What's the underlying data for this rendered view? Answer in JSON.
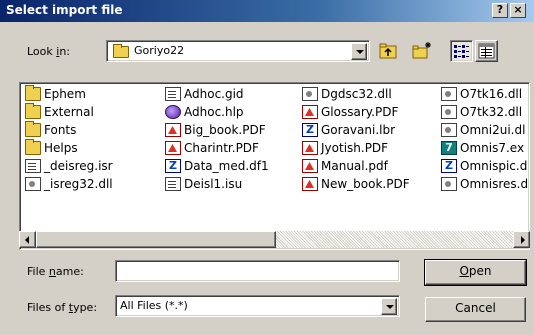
{
  "window": {
    "title": "Select import file",
    "help_label": "?",
    "close_label": "×"
  },
  "lookin": {
    "label_pre": "Look ",
    "label_key": "i",
    "label_post": "n:",
    "value": "Goriyo22"
  },
  "toolbar": {
    "up_icon": "folder-up-icon",
    "new_folder_icon": "new-folder-icon",
    "list_view_icon": "list-view-icon",
    "details_view_icon": "details-view-icon"
  },
  "files": [
    {
      "name": "Ephem",
      "type": "folder"
    },
    {
      "name": "External",
      "type": "folder"
    },
    {
      "name": "Fonts",
      "type": "folder"
    },
    {
      "name": "Helps",
      "type": "folder"
    },
    {
      "name": "_deisreg.isr",
      "type": "doc"
    },
    {
      "name": "_isreg32.dll",
      "type": "dll"
    },
    {
      "name": "Adhoc.gid",
      "type": "doc"
    },
    {
      "name": "Adhoc.hlp",
      "type": "hlp"
    },
    {
      "name": "Big_book.PDF",
      "type": "pdf"
    },
    {
      "name": "Charintr.PDF",
      "type": "pdf"
    },
    {
      "name": "Data_med.df1",
      "type": "z"
    },
    {
      "name": "Deisl1.isu",
      "type": "doc"
    },
    {
      "name": "Dgdsc32.dll",
      "type": "dll"
    },
    {
      "name": "Glossary.PDF",
      "type": "pdf"
    },
    {
      "name": "Goravani.lbr",
      "type": "z"
    },
    {
      "name": "Jyotish.PDF",
      "type": "pdf"
    },
    {
      "name": "Manual.pdf",
      "type": "pdf"
    },
    {
      "name": "New_book.PDF",
      "type": "pdf"
    },
    {
      "name": "O7tk16.dll",
      "type": "dll"
    },
    {
      "name": "O7tk32.dll",
      "type": "dll"
    },
    {
      "name": "Omni2ui.dl",
      "type": "dll"
    },
    {
      "name": "Omnis7.ex",
      "type": "z7"
    },
    {
      "name": "Omnispic.d",
      "type": "z"
    },
    {
      "name": "Omnisres.d",
      "type": "dll"
    }
  ],
  "filename": {
    "label_pre": "File ",
    "label_key": "n",
    "label_post": "ame:",
    "value": ""
  },
  "filetype": {
    "label_pre": "Files of ",
    "label_key": "t",
    "label_post": "ype:",
    "value": "All Files (*.*)"
  },
  "buttons": {
    "open_key": "O",
    "open_rest": "pen",
    "cancel": "Cancel"
  }
}
